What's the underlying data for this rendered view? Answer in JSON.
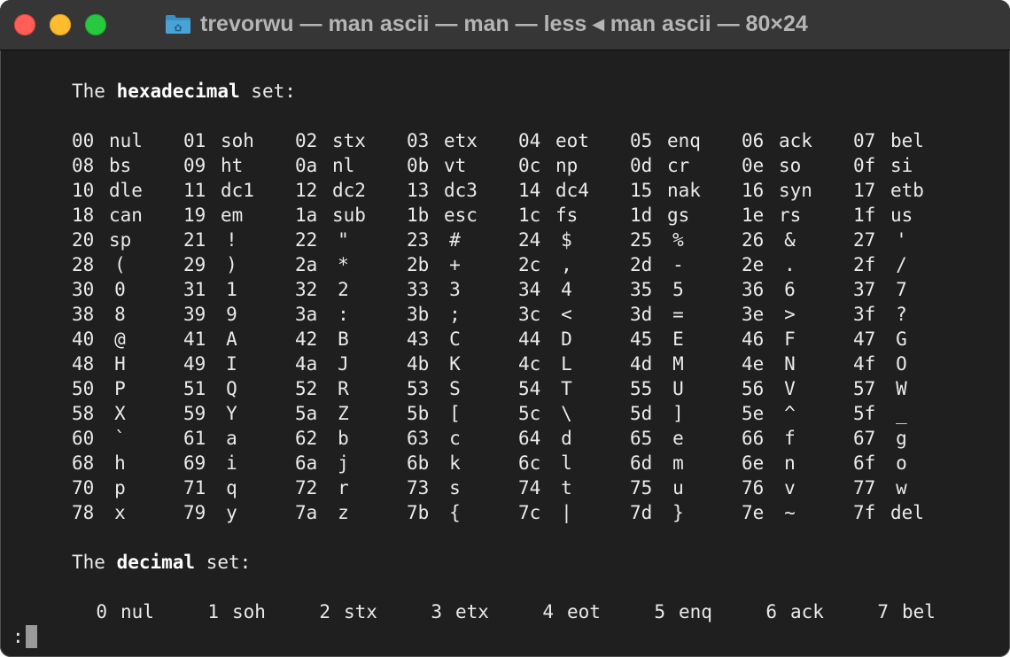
{
  "window": {
    "title": "trevorwu — man ascii — man — less ◂ man ascii — 80×24"
  },
  "terminal": {
    "hex_heading": {
      "prefix": "The ",
      "bold": "hexadecimal",
      "suffix": " set:"
    },
    "hex_rows": [
      [
        [
          "00",
          "nul"
        ],
        [
          "01",
          "soh"
        ],
        [
          "02",
          "stx"
        ],
        [
          "03",
          "etx"
        ],
        [
          "04",
          "eot"
        ],
        [
          "05",
          "enq"
        ],
        [
          "06",
          "ack"
        ],
        [
          "07",
          "bel"
        ]
      ],
      [
        [
          "08",
          "bs"
        ],
        [
          "09",
          "ht"
        ],
        [
          "0a",
          "nl"
        ],
        [
          "0b",
          "vt"
        ],
        [
          "0c",
          "np"
        ],
        [
          "0d",
          "cr"
        ],
        [
          "0e",
          "so"
        ],
        [
          "0f",
          "si"
        ]
      ],
      [
        [
          "10",
          "dle"
        ],
        [
          "11",
          "dc1"
        ],
        [
          "12",
          "dc2"
        ],
        [
          "13",
          "dc3"
        ],
        [
          "14",
          "dc4"
        ],
        [
          "15",
          "nak"
        ],
        [
          "16",
          "syn"
        ],
        [
          "17",
          "etb"
        ]
      ],
      [
        [
          "18",
          "can"
        ],
        [
          "19",
          "em"
        ],
        [
          "1a",
          "sub"
        ],
        [
          "1b",
          "esc"
        ],
        [
          "1c",
          "fs"
        ],
        [
          "1d",
          "gs"
        ],
        [
          "1e",
          "rs"
        ],
        [
          "1f",
          "us"
        ]
      ],
      [
        [
          "20",
          "sp"
        ],
        [
          "21",
          "!"
        ],
        [
          "22",
          "\""
        ],
        [
          "23",
          "#"
        ],
        [
          "24",
          "$"
        ],
        [
          "25",
          "%"
        ],
        [
          "26",
          "&"
        ],
        [
          "27",
          "'"
        ]
      ],
      [
        [
          "28",
          "("
        ],
        [
          "29",
          ")"
        ],
        [
          "2a",
          "*"
        ],
        [
          "2b",
          "+"
        ],
        [
          "2c",
          ","
        ],
        [
          "2d",
          "-"
        ],
        [
          "2e",
          "."
        ],
        [
          "2f",
          "/"
        ]
      ],
      [
        [
          "30",
          "0"
        ],
        [
          "31",
          "1"
        ],
        [
          "32",
          "2"
        ],
        [
          "33",
          "3"
        ],
        [
          "34",
          "4"
        ],
        [
          "35",
          "5"
        ],
        [
          "36",
          "6"
        ],
        [
          "37",
          "7"
        ]
      ],
      [
        [
          "38",
          "8"
        ],
        [
          "39",
          "9"
        ],
        [
          "3a",
          ":"
        ],
        [
          "3b",
          ";"
        ],
        [
          "3c",
          "<"
        ],
        [
          "3d",
          "="
        ],
        [
          "3e",
          ">"
        ],
        [
          "3f",
          "?"
        ]
      ],
      [
        [
          "40",
          "@"
        ],
        [
          "41",
          "A"
        ],
        [
          "42",
          "B"
        ],
        [
          "43",
          "C"
        ],
        [
          "44",
          "D"
        ],
        [
          "45",
          "E"
        ],
        [
          "46",
          "F"
        ],
        [
          "47",
          "G"
        ]
      ],
      [
        [
          "48",
          "H"
        ],
        [
          "49",
          "I"
        ],
        [
          "4a",
          "J"
        ],
        [
          "4b",
          "K"
        ],
        [
          "4c",
          "L"
        ],
        [
          "4d",
          "M"
        ],
        [
          "4e",
          "N"
        ],
        [
          "4f",
          "O"
        ]
      ],
      [
        [
          "50",
          "P"
        ],
        [
          "51",
          "Q"
        ],
        [
          "52",
          "R"
        ],
        [
          "53",
          "S"
        ],
        [
          "54",
          "T"
        ],
        [
          "55",
          "U"
        ],
        [
          "56",
          "V"
        ],
        [
          "57",
          "W"
        ]
      ],
      [
        [
          "58",
          "X"
        ],
        [
          "59",
          "Y"
        ],
        [
          "5a",
          "Z"
        ],
        [
          "5b",
          "["
        ],
        [
          "5c",
          "\\"
        ],
        [
          "5d",
          "]"
        ],
        [
          "5e",
          "^"
        ],
        [
          "5f",
          "_"
        ]
      ],
      [
        [
          "60",
          "`"
        ],
        [
          "61",
          "a"
        ],
        [
          "62",
          "b"
        ],
        [
          "63",
          "c"
        ],
        [
          "64",
          "d"
        ],
        [
          "65",
          "e"
        ],
        [
          "66",
          "f"
        ],
        [
          "67",
          "g"
        ]
      ],
      [
        [
          "68",
          "h"
        ],
        [
          "69",
          "i"
        ],
        [
          "6a",
          "j"
        ],
        [
          "6b",
          "k"
        ],
        [
          "6c",
          "l"
        ],
        [
          "6d",
          "m"
        ],
        [
          "6e",
          "n"
        ],
        [
          "6f",
          "o"
        ]
      ],
      [
        [
          "70",
          "p"
        ],
        [
          "71",
          "q"
        ],
        [
          "72",
          "r"
        ],
        [
          "73",
          "s"
        ],
        [
          "74",
          "t"
        ],
        [
          "75",
          "u"
        ],
        [
          "76",
          "v"
        ],
        [
          "77",
          "w"
        ]
      ],
      [
        [
          "78",
          "x"
        ],
        [
          "79",
          "y"
        ],
        [
          "7a",
          "z"
        ],
        [
          "7b",
          "{"
        ],
        [
          "7c",
          "|"
        ],
        [
          "7d",
          "}"
        ],
        [
          "7e",
          "~"
        ],
        [
          "7f",
          "del"
        ]
      ]
    ],
    "dec_heading": {
      "prefix": "The ",
      "bold": "decimal",
      "suffix": " set:"
    },
    "dec_rows": [
      [
        [
          "0",
          "nul"
        ],
        [
          "1",
          "soh"
        ],
        [
          "2",
          "stx"
        ],
        [
          "3",
          "etx"
        ],
        [
          "4",
          "eot"
        ],
        [
          "5",
          "enq"
        ],
        [
          "6",
          "ack"
        ],
        [
          "7",
          "bel"
        ]
      ]
    ],
    "prompt": ":"
  },
  "colors": {
    "terminal_bg": "#1f1f1f",
    "titlebar_bg": "#363636",
    "text": "#eaeaea",
    "close": "#ff5f57",
    "minimize": "#febc2e",
    "zoom": "#28c840",
    "folder": "#3a8fc2"
  },
  "icons": {
    "folder": "folder-icon"
  }
}
